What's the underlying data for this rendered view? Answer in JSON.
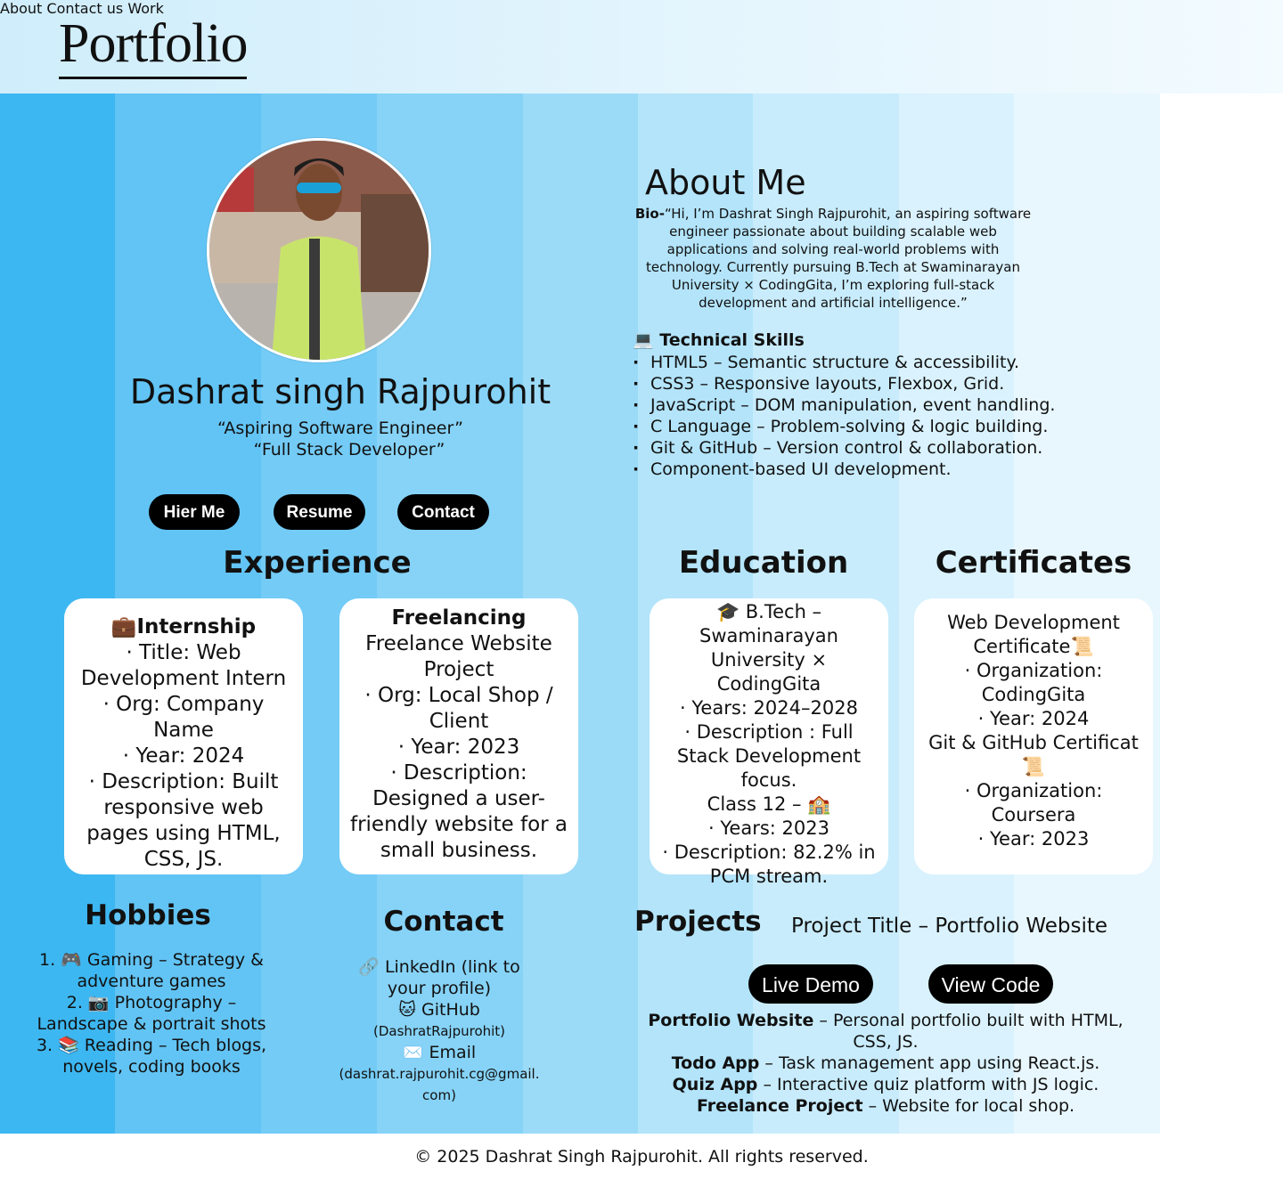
{
  "header": {
    "logo": "Portfolio",
    "nav": [
      "About",
      "Contact us",
      "Work"
    ]
  },
  "profile": {
    "name": "Dashrat singh Rajpurohit",
    "tagline_1": "“Aspiring Software Engineer”",
    "tagline_2": "“Full Stack Developer”",
    "buttons": [
      "Hier Me",
      "Resume",
      "Contact"
    ]
  },
  "about": {
    "title": "About Me",
    "bio_label": "Bio-",
    "bio_text": "“Hi, I’m Dashrat Singh Rajpurohit, an aspiring software engineer passionate about building scalable web applications and solving real-world problems with technology. Currently pursuing B.Tech at Swaminarayan University × CodingGita, I’m exploring full-stack development and artificial intelligence.”",
    "skills_icon": "💻",
    "skills_title": "Technical Skills",
    "skills": [
      "HTML5 – Semantic structure & accessibility.",
      "CSS3 – Responsive layouts, Flexbox, Grid.",
      "JavaScript – DOM manipulation, event handling.",
      "C Language – Problem-solving & logic building.",
      "Git & GitHub – Version control & collaboration.",
      "Component-based UI development."
    ]
  },
  "experience": {
    "title": "Experience",
    "internship": {
      "heading": "💼Internship",
      "lines": [
        "· Title: Web Development Intern",
        "· Org: Company Name",
        "· Year: 2024",
        "· Description: Built responsive web pages using HTML, CSS, JS."
      ]
    },
    "freelancing": {
      "heading": "Freelancing",
      "lines": [
        "Freelance Website Project",
        "· Org: Local Shop / Client",
        "· Year: 2023",
        "· Description: Designed a user-friendly website for a small business."
      ]
    }
  },
  "education": {
    "title": "Education",
    "lines": [
      "🎓 B.Tech – Swaminarayan University × CodingGita",
      "· Years: 2024–2028",
      "· Description : Full Stack Development focus.",
      "Class 12 – 🏫",
      "· Years: 2023",
      "· Description: 82.2% in PCM stream."
    ]
  },
  "certificates": {
    "title": "Certificates",
    "lines": [
      "Web Development Certificate📜",
      "· Organization: CodingGita",
      "· Year: 2024",
      "Git & GitHub Certificat📜",
      "· Organization: Coursera",
      "· Year: 2023"
    ]
  },
  "hobbies": {
    "title": "Hobbies",
    "items": [
      "1. 🎮 Gaming – Strategy & adventure games",
      "2. 📷 Photography – Landscape & portrait shots",
      "3. 📚 Reading – Tech blogs, novels, coding books"
    ]
  },
  "contact": {
    "title": "Contact",
    "linkedin": "🔗 LinkedIn (link to your profile)",
    "github": "🐱 GitHub",
    "github_handle": "(DashratRajpurohit)",
    "email": "✉️ Email",
    "email_addr": "(dashrat.rajpurohit.cg@gmail.com)"
  },
  "projects": {
    "title": "Projects",
    "project_title": "Project Title – Portfolio Website",
    "buttons": [
      "Live Demo",
      "View Code"
    ],
    "items": [
      {
        "name": "Portfolio Website",
        "desc": " – Personal portfolio built with HTML, CSS, JS."
      },
      {
        "name": "Todo App",
        "desc": " – Task management app using React.js."
      },
      {
        "name": "Quiz App",
        "desc": " – Interactive quiz platform with JS logic."
      },
      {
        "name": "Freelance Project",
        "desc": " – Website for local shop."
      }
    ]
  },
  "footer": "© 2025 Dashrat Singh Rajpurohit. All rights reserved.",
  "colors": {
    "stripes": [
      "#3db7f1",
      "#62c4f4",
      "#73cbf6",
      "#86d3f7",
      "#9cdbf8",
      "#b3e4fa",
      "#c8ecfc",
      "#d9f2fd",
      "#e8f7fe",
      "#f1fafe"
    ],
    "button_bg": "#000000",
    "card_bg": "#ffffff"
  }
}
